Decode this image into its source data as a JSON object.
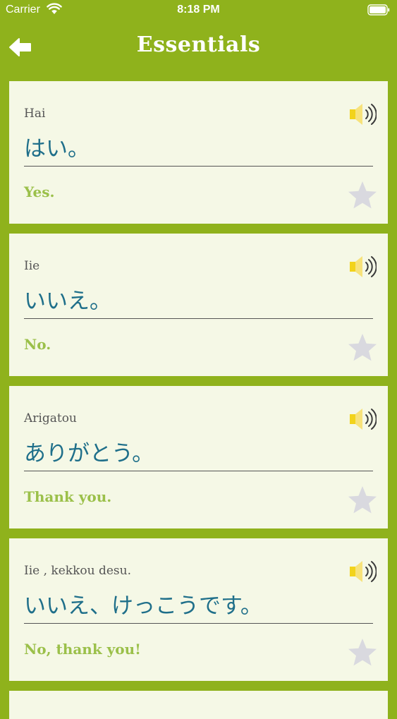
{
  "status_bar": {
    "carrier": "Carrier",
    "time": "8:18 PM"
  },
  "nav": {
    "title": "Essentials",
    "back_icon": "back-arrow-icon"
  },
  "colors": {
    "background": "#8fb21c",
    "card": "#f5f8e6",
    "japanese_text": "#1f6f8a",
    "translation_text": "#9bc04a",
    "star": "#d9d9df",
    "speaker": "#f2d31b"
  },
  "phrases": [
    {
      "romaji": "Hai",
      "japanese": "はい。",
      "translation": "Yes."
    },
    {
      "romaji": "Iie",
      "japanese": "いいえ。",
      "translation": "No."
    },
    {
      "romaji": "Arigatou",
      "japanese": "ありがとう。",
      "translation": "Thank you."
    },
    {
      "romaji": "Iie , kekkou desu.",
      "japanese": "いいえ、けっこうです。",
      "translation": "No, thank you!"
    }
  ]
}
